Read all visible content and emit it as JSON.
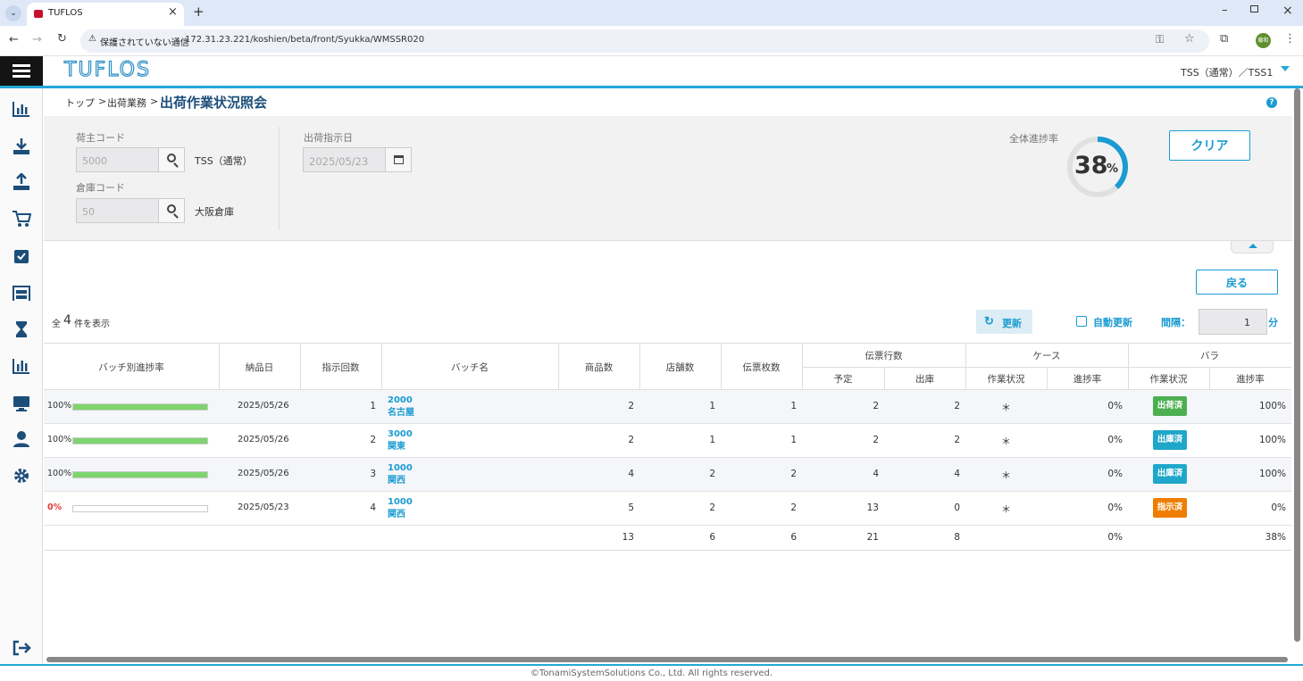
{
  "browser": {
    "tab_title": "TUFLOS",
    "new_tab": "+",
    "security_warning": "保護されていない通信",
    "url": "172.31.23.221/koshien/beta/front/Syukka/WMSSR020",
    "profile_initial": "藤和"
  },
  "app": {
    "logo": "TUFLOS",
    "user_context": "TSS（通常）／TSS1",
    "help": "?"
  },
  "breadcrumb": {
    "top": "トップ",
    "section": "出荷業務",
    "current": "出荷作業状況照会",
    "sep": ">"
  },
  "search": {
    "shipper_label": "荷主コード",
    "shipper_code": "5000",
    "shipper_name": "TSS（通常）",
    "warehouse_label": "倉庫コード",
    "warehouse_code": "50",
    "warehouse_name": "大阪倉庫",
    "date_label": "出荷指示日",
    "date_value": "2025/05/23",
    "progress_label": "全体進捗率",
    "progress_value": "38",
    "progress_unit": "%",
    "progress_fraction": 0.38,
    "clear_button": "クリア"
  },
  "list": {
    "back_button": "戻る",
    "count_prefix": "全",
    "count": "4",
    "count_suffix": "件を表示",
    "refresh_button": "更新",
    "auto_refresh_label": "自動更新",
    "interval_label": "間隔：",
    "interval_value": "1",
    "interval_unit": "分"
  },
  "table": {
    "headers": {
      "batch_progress": "バッチ別進捗率",
      "delivery_date": "納品日",
      "instruction_count": "指示回数",
      "batch_name": "バッチ名",
      "items": "商品数",
      "stores": "店舗数",
      "slips": "伝票枚数",
      "slip_lines": "伝票行数",
      "planned": "予定",
      "shipped": "出庫",
      "case": "ケース",
      "case_status": "作業状況",
      "case_rate": "進捗率",
      "piece": "バラ",
      "piece_status": "作業状況",
      "piece_rate": "進捗率"
    },
    "rows": [
      {
        "progress_text": "100%",
        "progress": 1.0,
        "date": "2025/05/26",
        "count": "1",
        "batch_code": "2000",
        "batch_area": "名古屋",
        "items": "2",
        "stores": "1",
        "slips": "1",
        "planned": "2",
        "shipped": "2",
        "case_status": "＊",
        "case_rate": "0%",
        "piece_status": "出荷済",
        "piece_rate": "100%"
      },
      {
        "progress_text": "100%",
        "progress": 1.0,
        "date": "2025/05/26",
        "count": "2",
        "batch_code": "3000",
        "batch_area": "関東",
        "items": "2",
        "stores": "1",
        "slips": "1",
        "planned": "2",
        "shipped": "2",
        "case_status": "＊",
        "case_rate": "0%",
        "piece_status": "出庫済",
        "piece_rate": "100%"
      },
      {
        "progress_text": "100%",
        "progress": 1.0,
        "date": "2025/05/26",
        "count": "3",
        "batch_code": "1000",
        "batch_area": "関西",
        "items": "4",
        "stores": "2",
        "slips": "2",
        "planned": "4",
        "shipped": "4",
        "case_status": "＊",
        "case_rate": "0%",
        "piece_status": "出庫済",
        "piece_rate": "100%"
      },
      {
        "progress_text": "0%",
        "progress": 0.0,
        "date": "2025/05/23",
        "count": "4",
        "batch_code": "1000",
        "batch_area": "関西",
        "items": "5",
        "stores": "2",
        "slips": "2",
        "planned": "13",
        "shipped": "0",
        "case_status": "＊",
        "case_rate": "0%",
        "piece_status": "指示済",
        "piece_rate": "0%"
      }
    ],
    "totals": {
      "items": "13",
      "stores": "6",
      "slips": "6",
      "planned": "21",
      "shipped": "8",
      "case_rate": "0%",
      "piece_rate": "38%"
    }
  },
  "colors": {
    "accent": "#23a8d8",
    "shipped_green": "#4caf50",
    "picked_cyan": "#1fa7c9",
    "instructed_orange": "#ef7d00",
    "bar_green": "#7ed46e"
  },
  "footer": {
    "copyright": "©TonamiSystemSolutions Co., Ltd. All rights reserved."
  }
}
